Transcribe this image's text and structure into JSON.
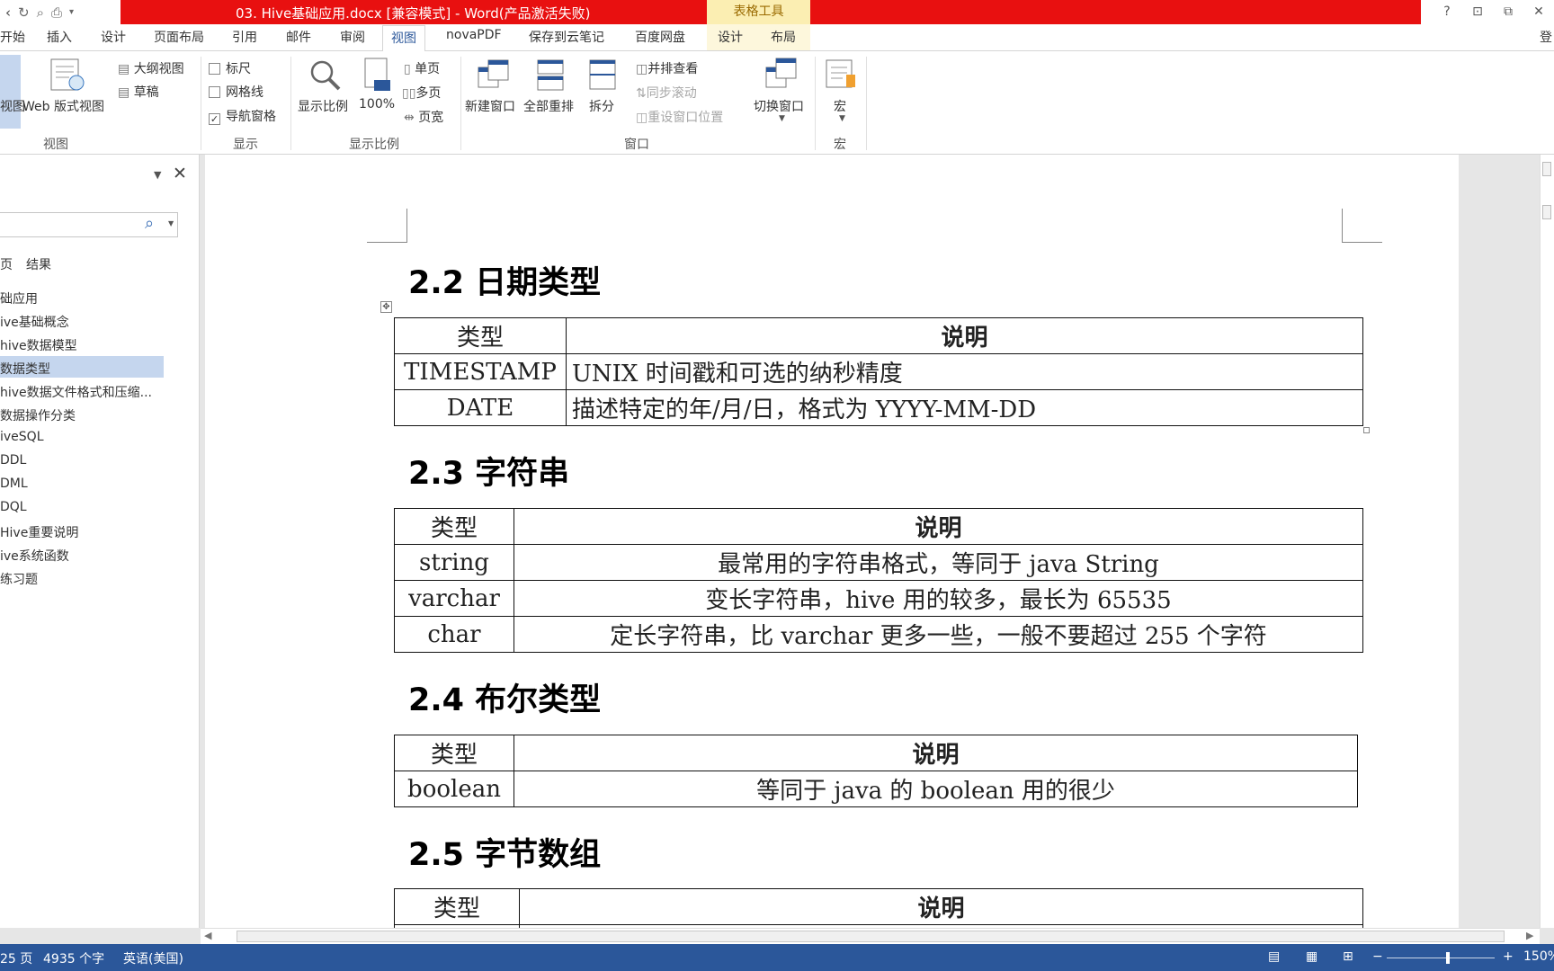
{
  "title_bar": {
    "document_title": "03. Hive基础应用.docx [兼容模式] -  Word(产品激活失败)",
    "context_tab_group": "表格工具",
    "window_controls": [
      "?",
      "⊡",
      "⧉",
      "⊡"
    ]
  },
  "tabs": [
    "开始",
    "插入",
    "设计",
    "页面布局",
    "引用",
    "邮件",
    "审阅",
    "视图",
    "novaPDF",
    "保存到云笔记",
    "百度网盘",
    "设计",
    "布局"
  ],
  "active_tab": "视图",
  "signin": "登",
  "ribbon": {
    "views_group": {
      "label": "视图",
      "read_label": "视图",
      "web_layout": "Web 版式视图",
      "outline": "大纲视图",
      "draft": "草稿"
    },
    "show_group": {
      "label": "显示",
      "ruler": "标尺",
      "gridlines": "网格线",
      "nav_pane": "导航窗格",
      "nav_pane_checked": true
    },
    "zoom_group": {
      "label": "显示比例",
      "zoom": "显示比例",
      "hundred": "100%",
      "one_page": "单页",
      "multi_page": "多页",
      "page_width": "页宽"
    },
    "window_group": {
      "label": "窗口",
      "new_window": "新建窗口",
      "arrange_all": "全部重排",
      "split": "拆分",
      "side_by_side": "并排查看",
      "sync_scroll": "同步滚动",
      "reset_position": "重设窗口位置",
      "switch_windows": "切换窗口"
    },
    "macros_group": {
      "label": "宏",
      "macros": "宏"
    }
  },
  "nav_pane": {
    "tabs": [
      "页",
      "结果"
    ],
    "items": [
      "础应用",
      "ive基础概念",
      "hive数据模型",
      "数据类型",
      "hive数据文件格式和压缩...",
      "数据操作分类",
      "iveSQL",
      "DDL",
      "DML",
      "DQL",
      "Hive重要说明",
      "ive系统函数",
      "练习题"
    ],
    "selected_index": 3
  },
  "document": {
    "sections": [
      {
        "heading": "2.2 日期类型",
        "header": [
          "类型",
          "说明"
        ],
        "rows": [
          [
            "TIMESTAMP",
            "UNIX 时间戳和可选的纳秒精度"
          ],
          [
            "DATE",
            "描述特定的年/月/日，格式为 YYYY-MM-DD"
          ]
        ]
      },
      {
        "heading": "2.3 字符串",
        "header": [
          "类型",
          "说明"
        ],
        "rows": [
          [
            "string",
            "最常用的字符串格式，等同于 java String"
          ],
          [
            "varchar",
            "变长字符串，hive 用的较多，最长为 65535"
          ],
          [
            "char",
            "定长字符串，比 varchar 更多一些，一般不要超过 255 个字符"
          ]
        ]
      },
      {
        "heading": "2.4 布尔类型",
        "header": [
          "类型",
          "说明"
        ],
        "rows": [
          [
            "boolean",
            "等同于 java 的 boolean 用的很少"
          ]
        ]
      },
      {
        "heading": "2.5 字节数组",
        "header": [
          "类型",
          "说明"
        ],
        "rows": []
      }
    ]
  },
  "status_bar": {
    "pages": "25 页",
    "words": "4935 个字",
    "language": "英语(美国)",
    "zoom": "150%"
  },
  "colors": {
    "title_red": "#e81010",
    "status_blue": "#2b579a",
    "nav_selected": "#c5d6ee"
  }
}
